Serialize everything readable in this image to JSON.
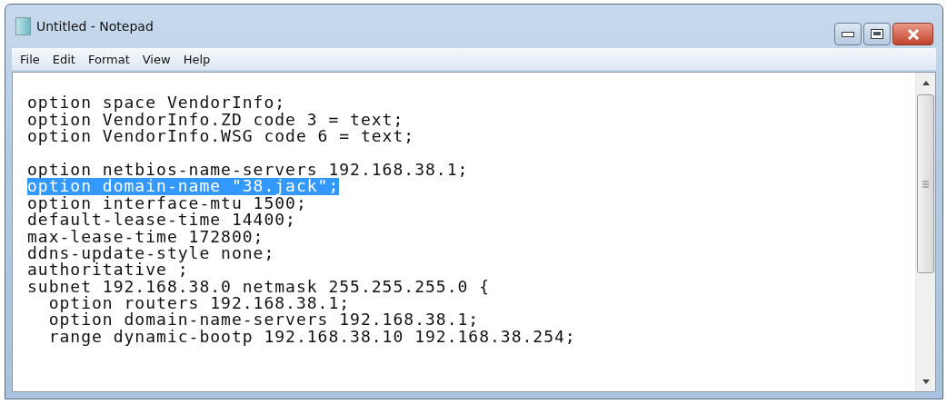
{
  "window": {
    "title": "Untitled - Notepad"
  },
  "menu": [
    "File",
    "Edit",
    "Format",
    "View",
    "Help"
  ],
  "editor": {
    "lines": [
      {
        "kind": "blank"
      },
      {
        "kind": "text",
        "text": "option space VendorInfo;",
        "selected": false
      },
      {
        "kind": "text",
        "text": "option VendorInfo.ZD code 3 = text;",
        "selected": false
      },
      {
        "kind": "text",
        "text": "option VendorInfo.WSG code 6 = text;",
        "selected": false
      },
      {
        "kind": "blank"
      },
      {
        "kind": "text",
        "text": "option netbios-name-servers 192.168.38.1;",
        "selected": false
      },
      {
        "kind": "text",
        "text": "option domain-name \"38.jack\";",
        "selected": true
      },
      {
        "kind": "text",
        "text": "option interface-mtu 1500;",
        "selected": false
      },
      {
        "kind": "text",
        "text": "default-lease-time 14400;",
        "selected": false
      },
      {
        "kind": "text",
        "text": "max-lease-time 172800;",
        "selected": false
      },
      {
        "kind": "text",
        "text": "ddns-update-style none;",
        "selected": false
      },
      {
        "kind": "text",
        "text": "authoritative ;",
        "selected": false
      },
      {
        "kind": "text",
        "text": "subnet 192.168.38.0 netmask 255.255.255.0 {",
        "selected": false
      },
      {
        "kind": "text",
        "text": "  option routers 192.168.38.1;",
        "selected": false
      },
      {
        "kind": "text",
        "text": "  option domain-name-servers 192.168.38.1;",
        "selected": false
      },
      {
        "kind": "text",
        "text": "  range dynamic-bootp 192.168.38.10 192.168.38.254;",
        "selected": false
      }
    ]
  }
}
